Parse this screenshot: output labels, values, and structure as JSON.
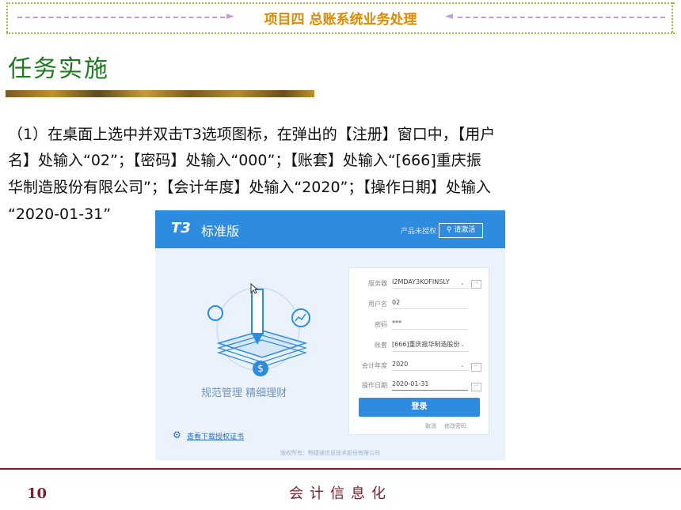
{
  "header": {
    "title": "项目四 总账系统业务处理"
  },
  "task": {
    "title": "任务实施"
  },
  "paragraph": {
    "line1": "（1）在桌面上选中并双击T3选项图标，在弹出的【注册】窗口中，【用户",
    "line2": "名】处输入“02”；【密码】处输入“000”；【账套】处输入“[666]重庆振",
    "line3": "华制造股份有限公司”；【会计年度】处输入“2020”；【操作日期】处输入",
    "line4": "“2020-01-31”"
  },
  "t3_window": {
    "logo": "T3",
    "logo_sub": "标准版",
    "unlicensed": "产品未授权",
    "activate_button": "请激活",
    "slogan": "规范管理  精细理财",
    "cert_link": "查看下载授权证书",
    "copyright": "版权所有：畅捷通信息技术股份有限公司",
    "form": {
      "server_label": "服务器",
      "server_value": "I2MDAY3KOFINSLY",
      "user_label": "用户名",
      "user_value": "02",
      "password_label": "密码",
      "password_value": "***",
      "account_label": "账套",
      "account_value": "[666]重庆振华制造股份",
      "year_label": "会计年度",
      "year_value": "2020",
      "date_label": "操作日期",
      "date_value": "2020-01-31",
      "login_button": "登录",
      "cancel_link": "取消",
      "change_password_link": "修改密码"
    }
  },
  "footer": {
    "page_number": "10",
    "title": "会计信息化"
  },
  "colors": {
    "accent_blue": "#2d8be0",
    "footer_red": "#7a1f2b",
    "title_green": "#1f7a1f",
    "banner_orange": "#e08a00"
  }
}
